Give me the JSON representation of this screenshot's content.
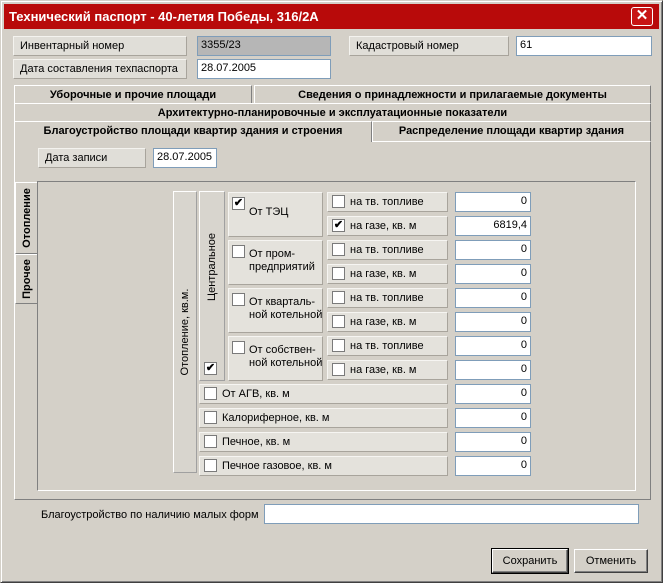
{
  "window": {
    "title": "Технический паспорт - 40-летия Победы, 316/2А"
  },
  "header": {
    "inventory_label": "Инвентарный номер",
    "inventory_value": "3355/23",
    "cadastral_label": "Кадастровый номер",
    "cadastral_value": "61",
    "date_label": "Дата составления техпаспорта",
    "date_value": "28.07.2005"
  },
  "tabs": {
    "row1": [
      "Уборочные и прочие площади",
      "Сведения о принадлежности и прилагаемые документы"
    ],
    "row2": [
      "Архитектурно-планировочные и эксплуатационные показатели"
    ],
    "row3": [
      "Благоустройство площади квартир здания и строения",
      "Распределение площади квартир здания"
    ],
    "active": "Благоустройство площади квартир здания и строения"
  },
  "record": {
    "label": "Дата записи",
    "value": "28.07.2005"
  },
  "side_tabs": [
    "Отопление",
    "Прочее"
  ],
  "heating": {
    "group_label": "Отопление, кв.м.",
    "central_label": "Центральное",
    "central_checked": true,
    "sources": [
      {
        "label": "От ТЭЦ",
        "checked": true,
        "rows": [
          {
            "label": "на тв. топливе",
            "checked": false,
            "value": "0"
          },
          {
            "label": "на газе, кв. м",
            "checked": true,
            "value": "6819,4"
          }
        ]
      },
      {
        "label": "От пром-\nпредприятий",
        "checked": false,
        "rows": [
          {
            "label": "на тв. топливе",
            "checked": false,
            "value": "0"
          },
          {
            "label": "на газе, кв. м",
            "checked": false,
            "value": "0"
          }
        ]
      },
      {
        "label": "От кварталь-\nной котельной",
        "checked": false,
        "rows": [
          {
            "label": "на тв. топливе",
            "checked": false,
            "value": "0"
          },
          {
            "label": "на газе, кв. м",
            "checked": false,
            "value": "0"
          }
        ]
      },
      {
        "label": "От собствен-\nной котельной",
        "checked": false,
        "rows": [
          {
            "label": "на тв. топливе",
            "checked": false,
            "value": "0"
          },
          {
            "label": "на газе, кв. м",
            "checked": false,
            "value": "0"
          }
        ]
      }
    ],
    "other": [
      {
        "label": "От АГВ, кв. м",
        "checked": false,
        "value": "0"
      },
      {
        "label": "Калориферное, кв. м",
        "checked": false,
        "value": "0"
      },
      {
        "label": "Печное, кв. м",
        "checked": false,
        "value": "0"
      },
      {
        "label": "Печное газовое, кв. м",
        "checked": false,
        "value": "0"
      }
    ]
  },
  "small_forms": {
    "label": "Благоустройство по наличию малых форм",
    "value": ""
  },
  "buttons": {
    "save": "Сохранить",
    "cancel": "Отменить"
  }
}
